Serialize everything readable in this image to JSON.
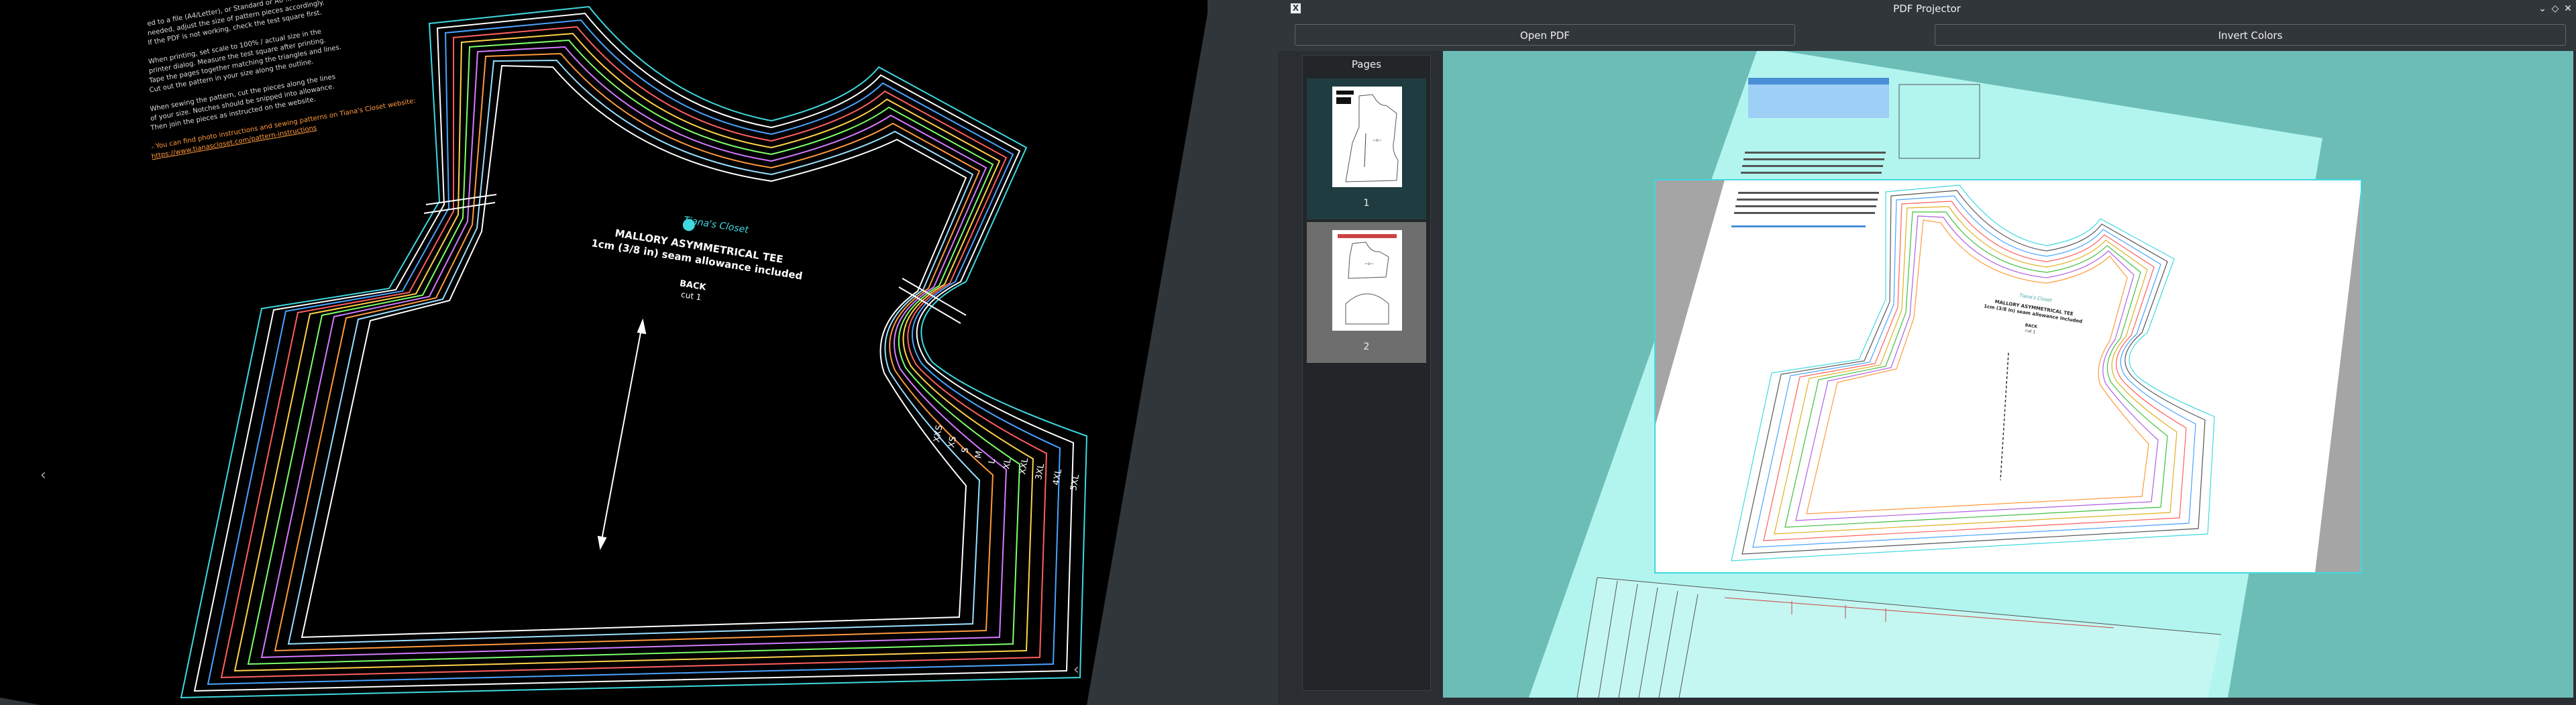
{
  "window": {
    "title": "PDF Projector",
    "buttons": {
      "minimize": "⌄",
      "maximize": "◇",
      "close": "✕"
    }
  },
  "toolbar": {
    "open_pdf_label": "Open PDF",
    "invert_colors_label": "Invert Colors"
  },
  "pages_panel": {
    "title": "Pages",
    "pages": [
      {
        "number": "1",
        "selected": true
      },
      {
        "number": "2",
        "selected": false
      }
    ]
  },
  "pattern": {
    "brand": "Tiana's Closet",
    "title": "MALLORY ASYMMETRICAL TEE",
    "seam_note": "1cm (3/8 in) seam allowance included",
    "piece": "BACK",
    "cut": "cut 1",
    "sizes": [
      "XXS",
      "XS",
      "S",
      "M",
      "L",
      "XL",
      "XXL",
      "3XL",
      "4XL",
      "5XL"
    ],
    "instructions_lines": [
      "- You can find photo instructions and sewing patterns on Tiana's Closet website:",
      "https://www.tianascloset.com/pattern-instructions"
    ]
  },
  "colors": {
    "accent_cyan": "#3fd9e0",
    "preview_bg": "#6dbdb7",
    "paper_tint": "#b2f5ef",
    "selected_thumb_bg": "#1f3d40",
    "unselected_thumb_bg": "#6e6e6e"
  }
}
